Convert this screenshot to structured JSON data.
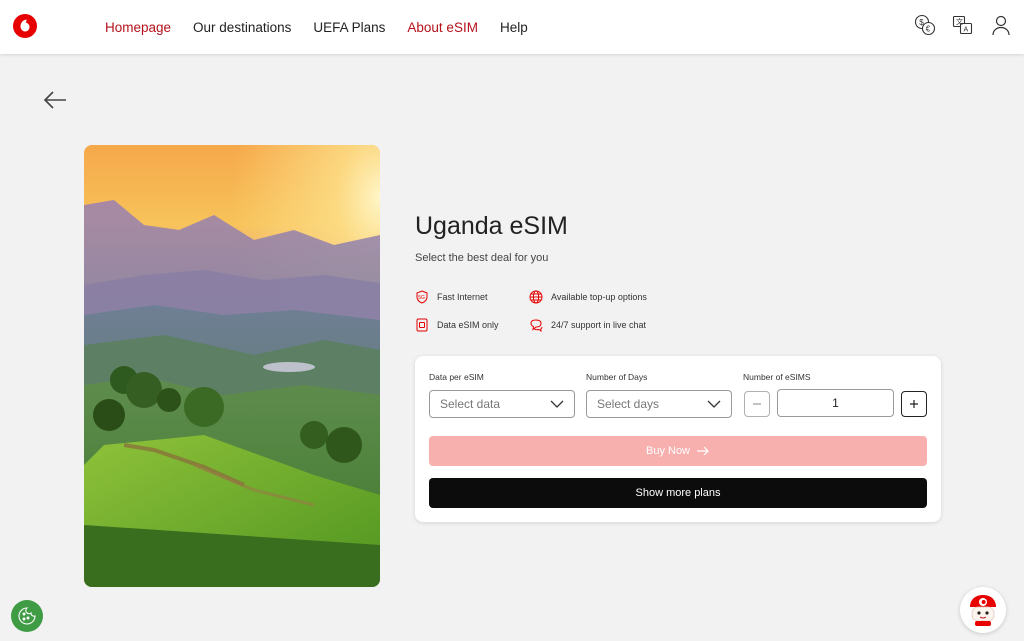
{
  "nav": {
    "items": [
      {
        "label": "Homepage",
        "active": true
      },
      {
        "label": "Our destinations",
        "active": false
      },
      {
        "label": "UEFA Plans",
        "active": false
      },
      {
        "label": "About eSIM",
        "active": true
      },
      {
        "label": "Help",
        "active": false
      }
    ]
  },
  "header_icons": [
    "currency-icon",
    "language-icon",
    "user-icon"
  ],
  "product": {
    "title": "Uganda eSIM",
    "subtitle": "Select the best deal for you"
  },
  "features": [
    {
      "icon": "5g-icon",
      "label": "Fast Internet"
    },
    {
      "icon": "globe-icon",
      "label": "Available top-up options"
    },
    {
      "icon": "sim-icon",
      "label": "Data eSIM only"
    },
    {
      "icon": "chat-support-icon",
      "label": "24/7 support in live chat"
    }
  ],
  "form": {
    "data_label": "Data per eSIM",
    "data_placeholder": "Select data",
    "days_label": "Number of Days",
    "days_placeholder": "Select days",
    "count_label": "Number of eSIMS",
    "count_value": "1",
    "buy_label": "Buy Now",
    "more_label": "Show more plans"
  },
  "colors": {
    "brand_red": "#e60000",
    "nav_active": "#b5121b",
    "buy_disabled": "#f7b0ae",
    "cookie_green": "#3f9c45"
  }
}
